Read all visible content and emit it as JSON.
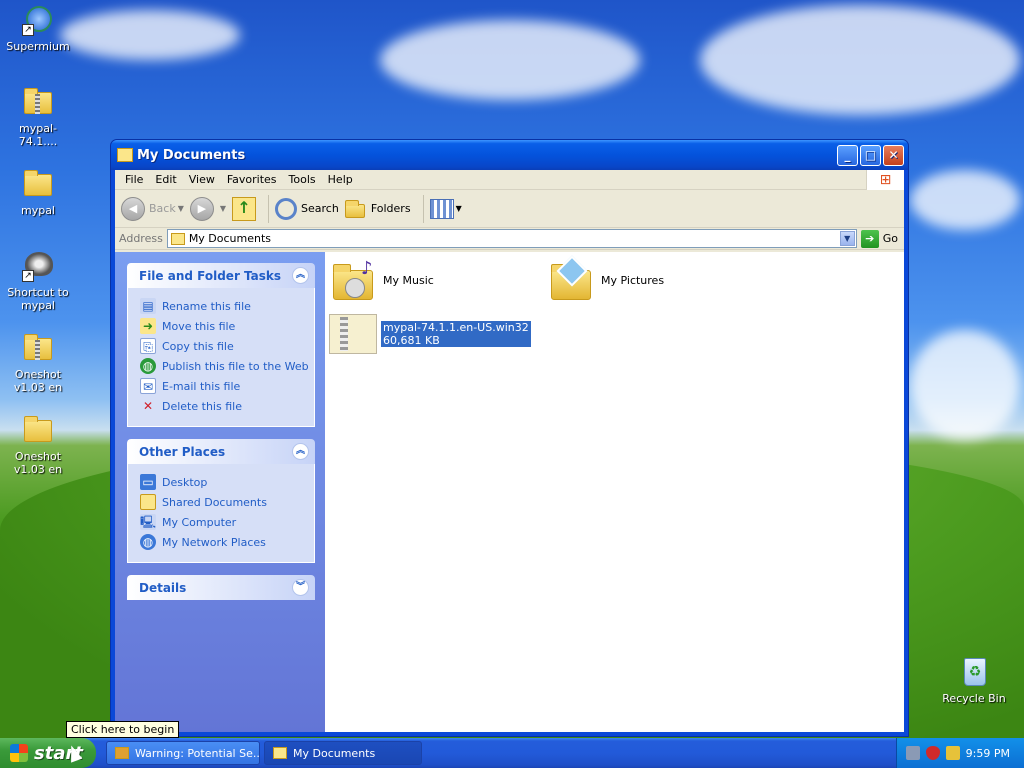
{
  "desktop": {
    "icons": [
      {
        "label": "Supermium",
        "icon": "supermium-shortcut-icon"
      },
      {
        "label": "mypal-74.1....",
        "icon": "zip-folder-icon"
      },
      {
        "label": "mypal",
        "icon": "folder-icon"
      },
      {
        "label": "Shortcut to mypal",
        "icon": "raccoon-shortcut-icon"
      },
      {
        "label": "Oneshot v1.03 en",
        "icon": "zip-folder-icon"
      },
      {
        "label": "Oneshot v1.03 en",
        "icon": "folder-icon"
      },
      {
        "label": "Recycle Bin",
        "icon": "recycle-bin-icon"
      }
    ]
  },
  "window": {
    "title": "My Documents",
    "buttons": {
      "minimize": "_",
      "maximize": "□",
      "close": "✕"
    },
    "menu": [
      "File",
      "Edit",
      "View",
      "Favorites",
      "Tools",
      "Help"
    ],
    "toolbar": {
      "back": "Back",
      "search": "Search",
      "folders": "Folders"
    },
    "address": {
      "label": "Address",
      "value": "My Documents",
      "go": "Go"
    },
    "taskpane": {
      "file_tasks": {
        "title": "File and Folder Tasks",
        "items": [
          {
            "label": "Rename this file",
            "icon": "rename-icon"
          },
          {
            "label": "Move this file",
            "icon": "move-icon"
          },
          {
            "label": "Copy this file",
            "icon": "copy-icon"
          },
          {
            "label": "Publish this file to the Web",
            "icon": "globe-icon"
          },
          {
            "label": "E-mail this file",
            "icon": "email-icon"
          },
          {
            "label": "Delete this file",
            "icon": "delete-icon"
          }
        ]
      },
      "other_places": {
        "title": "Other Places",
        "items": [
          {
            "label": "Desktop",
            "icon": "desktop-icon"
          },
          {
            "label": "Shared Documents",
            "icon": "folder-icon"
          },
          {
            "label": "My Computer",
            "icon": "computer-icon"
          },
          {
            "label": "My Network Places",
            "icon": "network-icon"
          }
        ]
      },
      "details": {
        "title": "Details"
      }
    },
    "files": [
      {
        "name": "My Music",
        "icon": "music-folder-icon"
      },
      {
        "name": "My Pictures",
        "icon": "pictures-folder-icon"
      },
      {
        "name": "mypal-74.1.1.en-US.win32",
        "size": "60,681 KB",
        "icon": "zip-file-icon",
        "selected": true
      }
    ]
  },
  "taskbar": {
    "start": "start",
    "tooltip": "Click here to begin",
    "tasks": [
      {
        "label": "Warning: Potential Se...",
        "active": false
      },
      {
        "label": "My Documents",
        "active": true
      }
    ],
    "clock": "9:59 PM"
  }
}
